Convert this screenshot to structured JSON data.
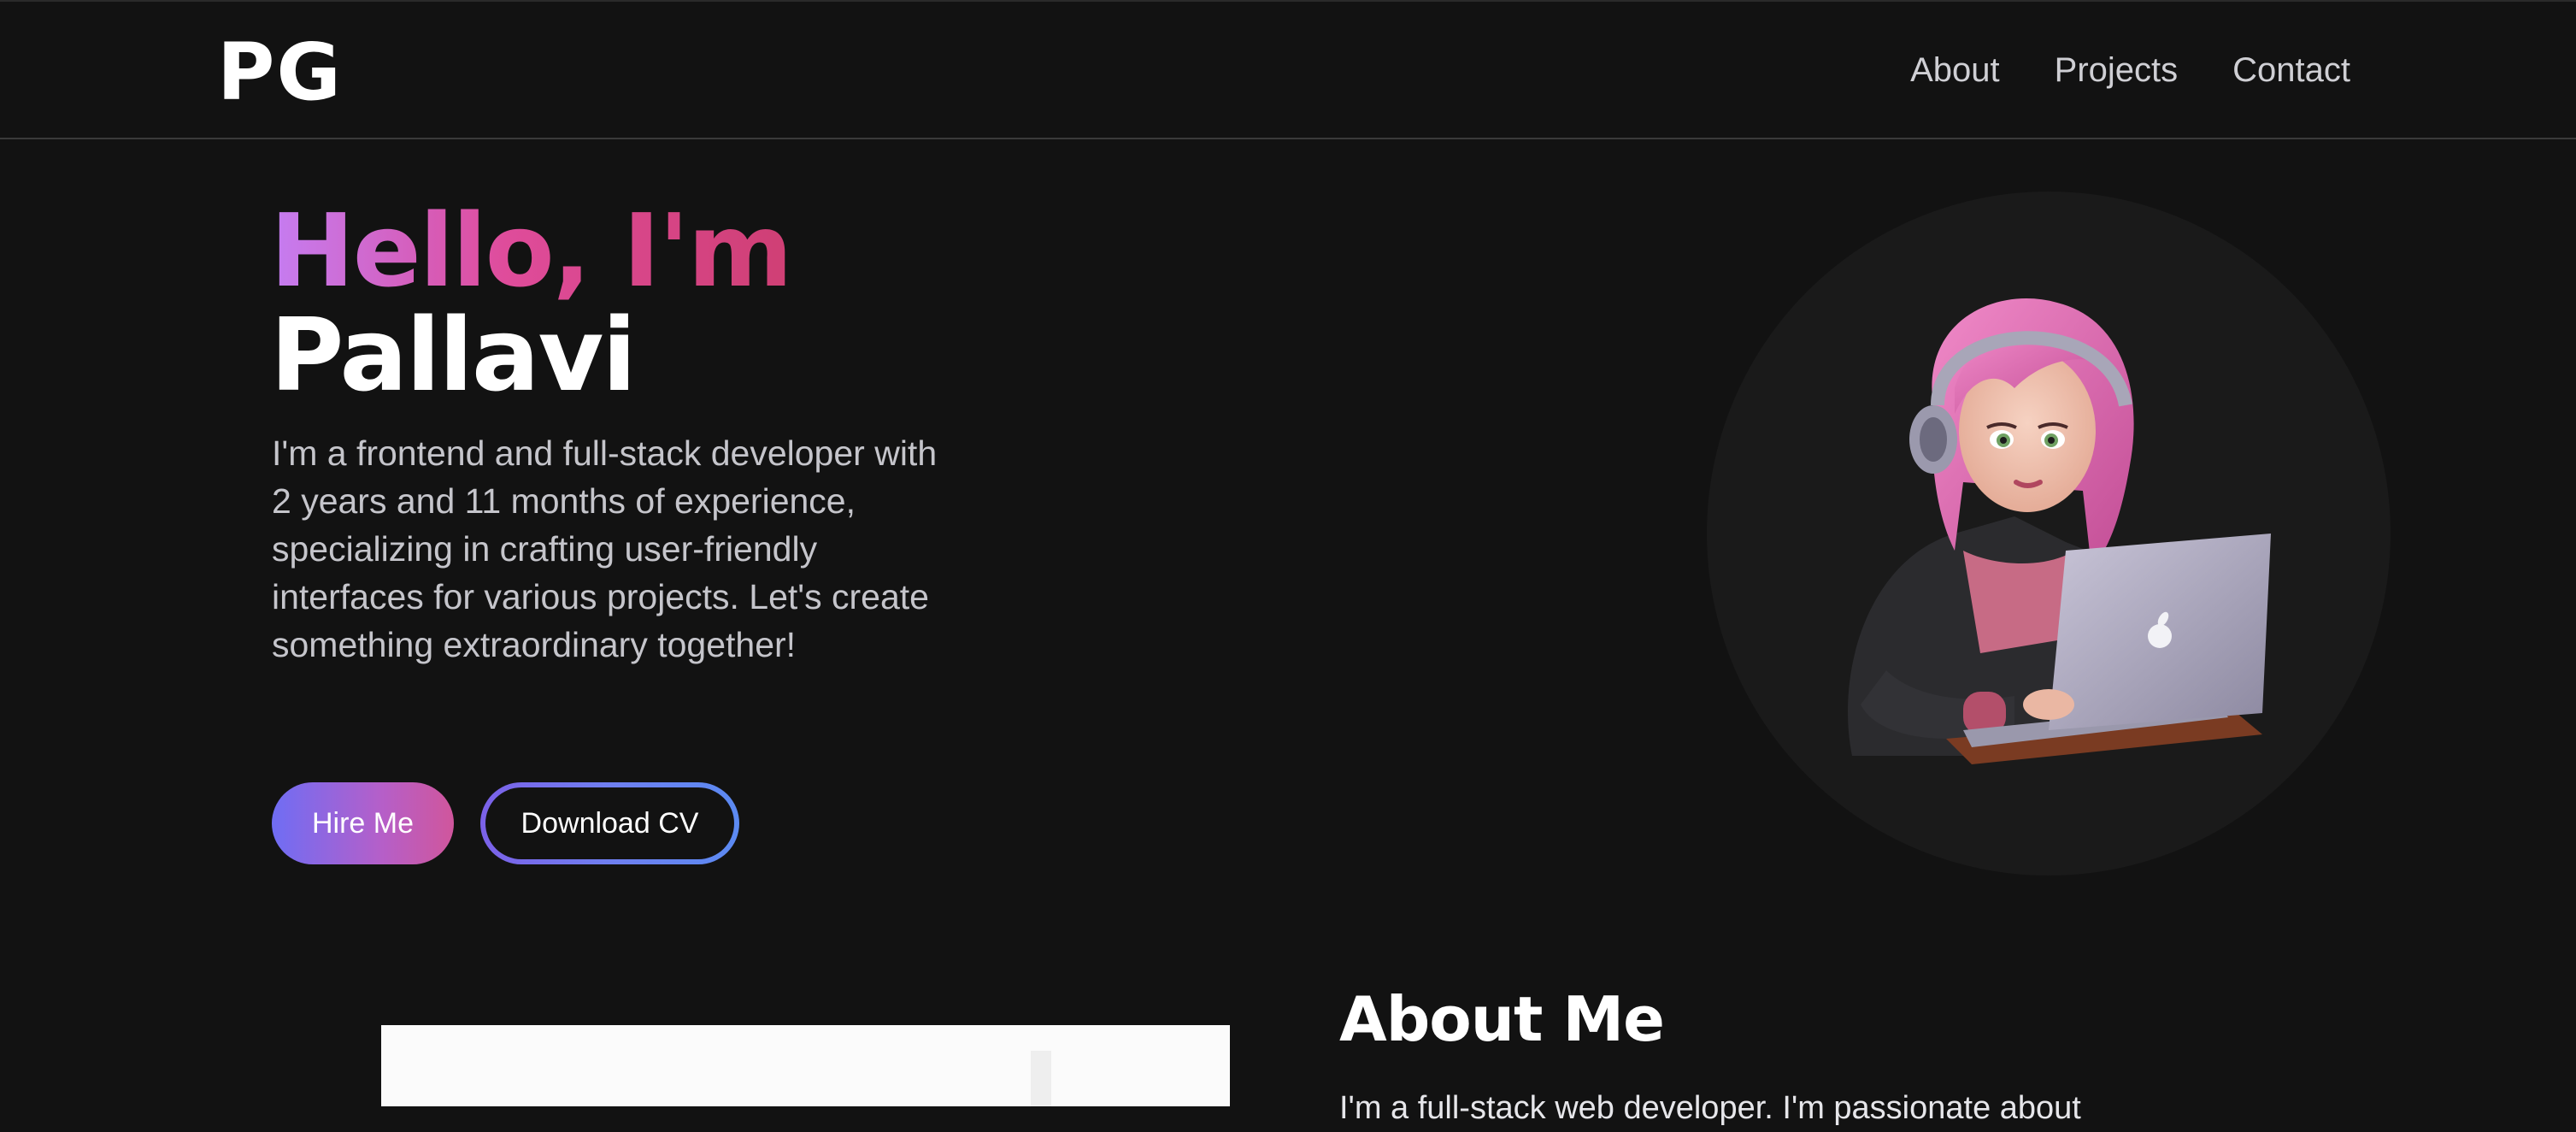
{
  "nav": {
    "logo": "PG",
    "links": [
      "About",
      "Projects",
      "Contact"
    ]
  },
  "hero": {
    "greeting": "Hello, I'm",
    "name": "Pallavi",
    "description": "I'm a frontend and full-stack developer with 2 years and 11 months of experience, specializing in crafting user-friendly interfaces for various projects. Let's create something extraordinary together!",
    "hire_button": "Hire Me",
    "cv_button": "Download CV"
  },
  "about": {
    "title": "About Me",
    "text": "I'm a full-stack web developer. I'm passionate about"
  },
  "colors": {
    "background": "#121212",
    "accent_purple": "#c57df2",
    "accent_pink": "#cf3f74",
    "button_gradient_start": "#6f6df4",
    "button_gradient_end": "#d0569c"
  },
  "icons": {
    "avatar": "developer-girl-with-laptop-avatar",
    "laptop_logo": "apple-logo-icon"
  }
}
